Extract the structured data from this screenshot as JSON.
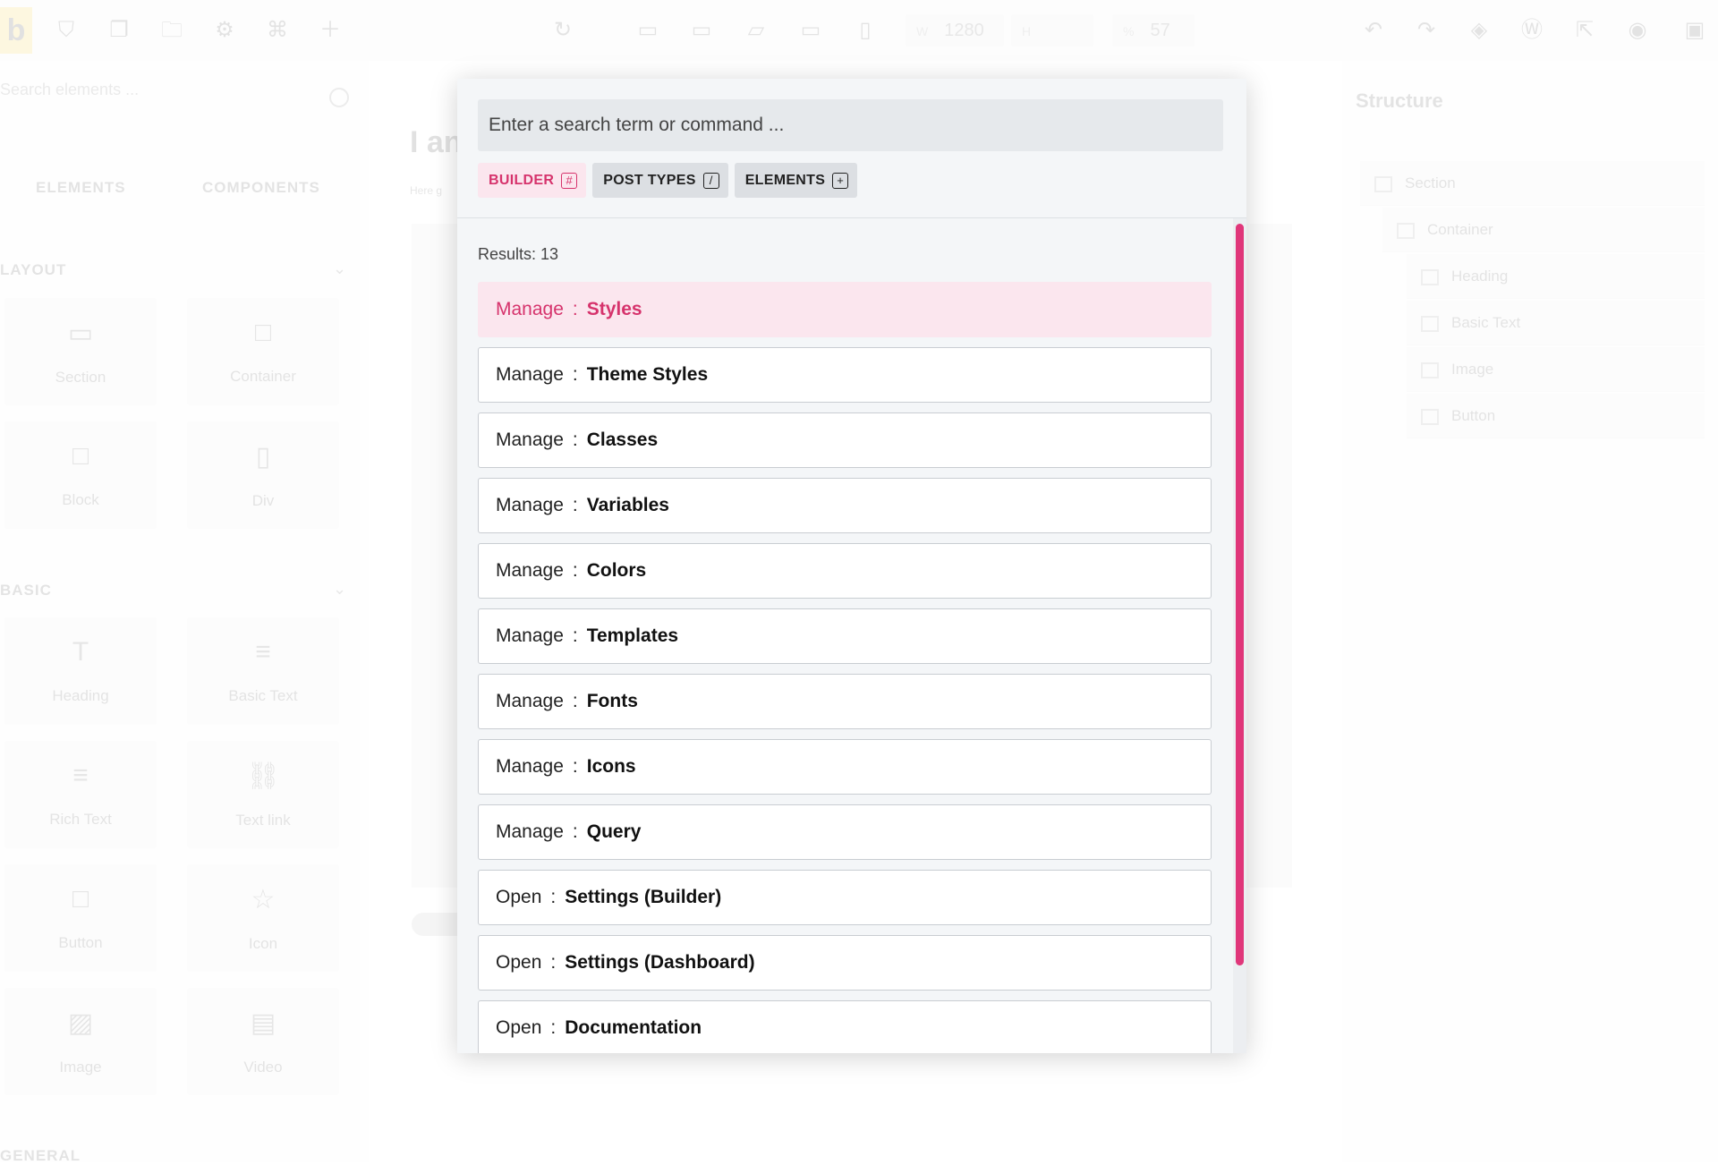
{
  "toolbar": {
    "logo_text": "b",
    "width_label": "W",
    "width_value": "1280",
    "height_label": "H",
    "height_value": "",
    "zoom_label": "%",
    "zoom_value": "57"
  },
  "left_panel": {
    "search_placeholder": "Search elements ...",
    "tabs": [
      "ELEMENTS",
      "COMPONENTS"
    ],
    "categories": {
      "layout": "LAYOUT",
      "basic": "BASIC",
      "general": "GENERAL"
    },
    "elements": [
      {
        "name": "Section",
        "icon": "▭"
      },
      {
        "name": "Container",
        "icon": "□"
      },
      {
        "name": "Block",
        "icon": "□"
      },
      {
        "name": "Div",
        "icon": "▯"
      },
      {
        "name": "Heading",
        "icon": "T"
      },
      {
        "name": "Basic Text",
        "icon": "≡"
      },
      {
        "name": "Rich Text",
        "icon": "≡"
      },
      {
        "name": "Text link",
        "icon": "⛓"
      },
      {
        "name": "Button",
        "icon": "□"
      },
      {
        "name": "Icon",
        "icon": "☆"
      },
      {
        "name": "Image",
        "icon": "▨"
      },
      {
        "name": "Video",
        "icon": "▤"
      }
    ]
  },
  "canvas": {
    "title": "I an",
    "subtitle": "Here g"
  },
  "structure": {
    "title": "Structure",
    "items": [
      "Section",
      "Container",
      "Heading",
      "Basic Text",
      "Image",
      "Button"
    ]
  },
  "command_palette": {
    "search_placeholder": "Enter a search term or command ...",
    "search_value": "",
    "filter_tabs": [
      {
        "label": "BUILDER",
        "key": "#"
      },
      {
        "label": "POST TYPES",
        "key": "/"
      },
      {
        "label": "ELEMENTS",
        "key": "+"
      }
    ],
    "results_count": "Results: 13",
    "separator": ":",
    "results": [
      {
        "prefix": "Manage",
        "name": "Styles"
      },
      {
        "prefix": "Manage",
        "name": "Theme Styles"
      },
      {
        "prefix": "Manage",
        "name": "Classes"
      },
      {
        "prefix": "Manage",
        "name": "Variables"
      },
      {
        "prefix": "Manage",
        "name": "Colors"
      },
      {
        "prefix": "Manage",
        "name": "Templates"
      },
      {
        "prefix": "Manage",
        "name": "Fonts"
      },
      {
        "prefix": "Manage",
        "name": "Icons"
      },
      {
        "prefix": "Manage",
        "name": "Query"
      },
      {
        "prefix": "Open",
        "name": "Settings (Builder)"
      },
      {
        "prefix": "Open",
        "name": "Settings (Dashboard)"
      },
      {
        "prefix": "Open",
        "name": "Documentation"
      }
    ],
    "accent_color": "#d6336c"
  }
}
